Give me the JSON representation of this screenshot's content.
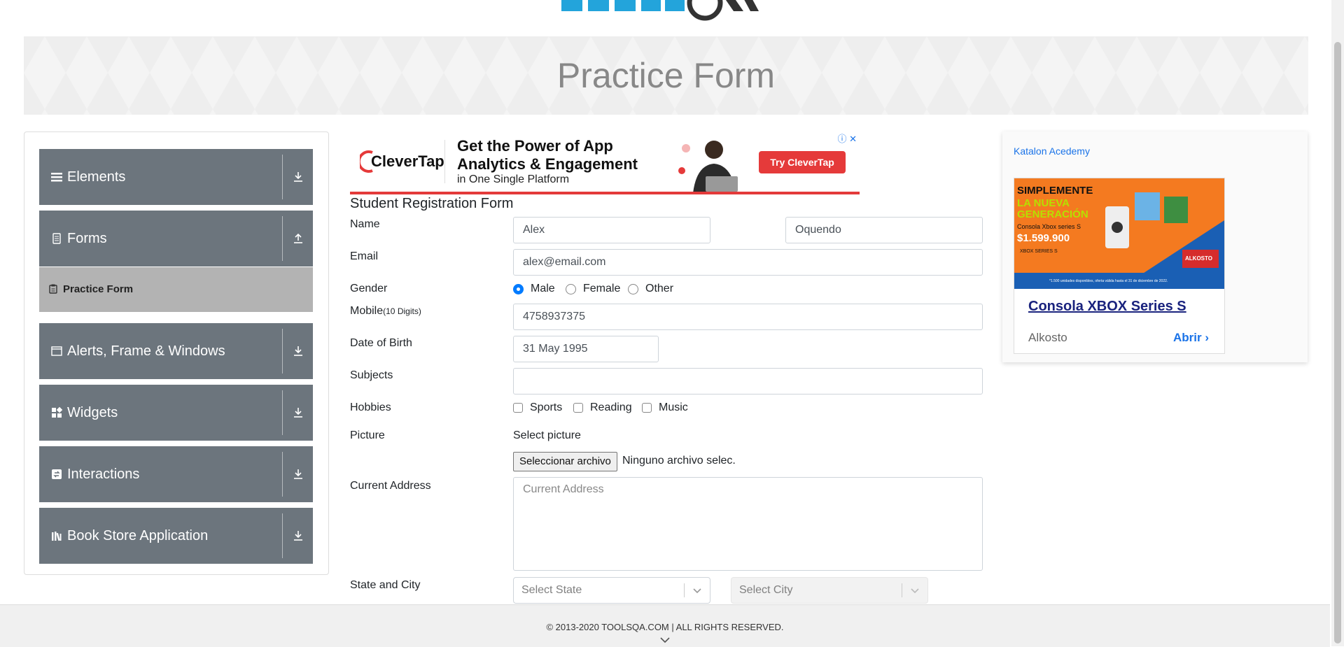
{
  "header": {
    "logo_icon": "toolsqa-logo-icon"
  },
  "banner": {
    "title": "Practice Form"
  },
  "sidebar": {
    "groups": [
      {
        "label": "Elements",
        "icon": "hamburger-icon",
        "arrow": "download-arrow-icon"
      },
      {
        "label": "Forms",
        "icon": "document-icon",
        "arrow": "upload-arrow-icon"
      },
      {
        "label": "Alerts, Frame & Windows",
        "icon": "window-icon",
        "arrow": "download-arrow-icon"
      },
      {
        "label": "Widgets",
        "icon": "widgets-icon",
        "arrow": "download-arrow-icon"
      },
      {
        "label": "Interactions",
        "icon": "interactions-icon",
        "arrow": "download-arrow-icon"
      },
      {
        "label": "Book Store Application",
        "icon": "books-icon",
        "arrow": "download-arrow-icon"
      }
    ],
    "active_item": {
      "label": "Practice Form",
      "icon": "clipboard-icon"
    }
  },
  "ad_top": {
    "brand": "CleverTap",
    "headline_1": "Get the Power of App",
    "headline_2": "Analytics & Engagement",
    "subline": "in One Single Platform",
    "cta": "Try CleverTap",
    "accent_color": "#e53a3a"
  },
  "form": {
    "title": "Student Registration Form",
    "name_label": "Name",
    "first_name": "Alex",
    "last_name": "Oquendo",
    "email_label": "Email",
    "email": "alex@email.com",
    "gender_label": "Gender",
    "gender_options": [
      "Male",
      "Female",
      "Other"
    ],
    "gender_selected": "Male",
    "mobile_label": "Mobile",
    "mobile_hint": "(10 Digits)",
    "mobile": "4758937375",
    "dob_label": "Date of Birth",
    "dob": "31 May 1995",
    "subjects_label": "Subjects",
    "subjects": "",
    "hobbies_label": "Hobbies",
    "hobbies": [
      "Sports",
      "Reading",
      "Music"
    ],
    "picture_label": "Picture",
    "picture_hint": "Select picture",
    "file_button": "Seleccionar archivo",
    "file_status": "Ninguno archivo selec.",
    "address_label": "Current Address",
    "address_placeholder": "Current Address",
    "state_city_label": "State and City",
    "state_placeholder": "Select State",
    "city_placeholder": "Select City"
  },
  "ad_right": {
    "alt_text": "Katalon Acedemy",
    "title": "Consola XBOX Series S",
    "advertiser": "Alkosto",
    "open": "Abrir",
    "img_line1": "SIMPLEMENTE",
    "img_line2": "LA NUEVA",
    "img_line3": "GENERACIÓN",
    "img_line4": "Consola Xbox series S",
    "img_price": "$1.599.900",
    "img_line5": "XBOX SERIES S",
    "img_brand": "ALKOSTO",
    "img_fine": "*1.500 unidades disponibles, oferta válida hasta el 31 de diciembre de 2022."
  },
  "footer": {
    "text": "© 2013-2020 TOOLSQA.COM | ALL RIGHTS RESERVED."
  }
}
